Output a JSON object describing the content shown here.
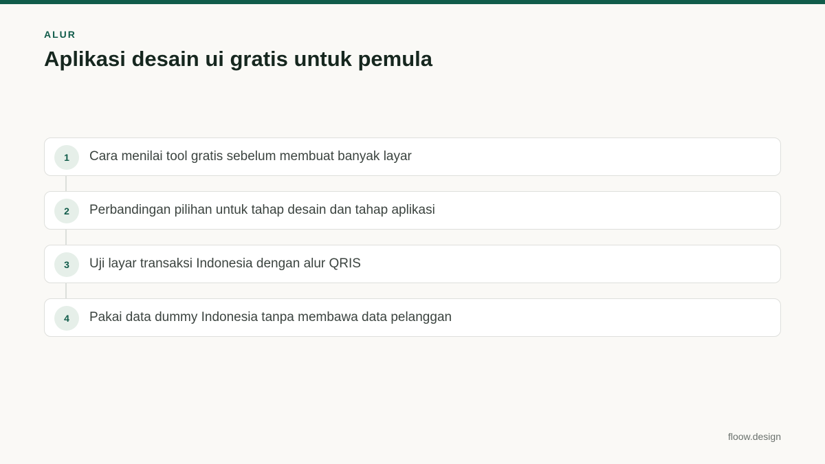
{
  "colors": {
    "accent": "#115c4a",
    "background": "#faf9f6",
    "title": "#16271f",
    "card_border": "#dedfdc",
    "number_bg": "#e6efe9"
  },
  "header": {
    "eyebrow": "ALUR",
    "title": "Aplikasi desain ui gratis untuk pemula"
  },
  "steps": [
    {
      "number": "1",
      "text": "Cara menilai tool gratis sebelum membuat banyak layar"
    },
    {
      "number": "2",
      "text": "Perbandingan pilihan untuk tahap desain dan tahap aplikasi"
    },
    {
      "number": "3",
      "text": "Uji layar transaksi Indonesia dengan alur QRIS"
    },
    {
      "number": "4",
      "text": "Pakai data dummy Indonesia tanpa membawa data pelanggan"
    }
  ],
  "footer": {
    "brand": "floow.design"
  }
}
